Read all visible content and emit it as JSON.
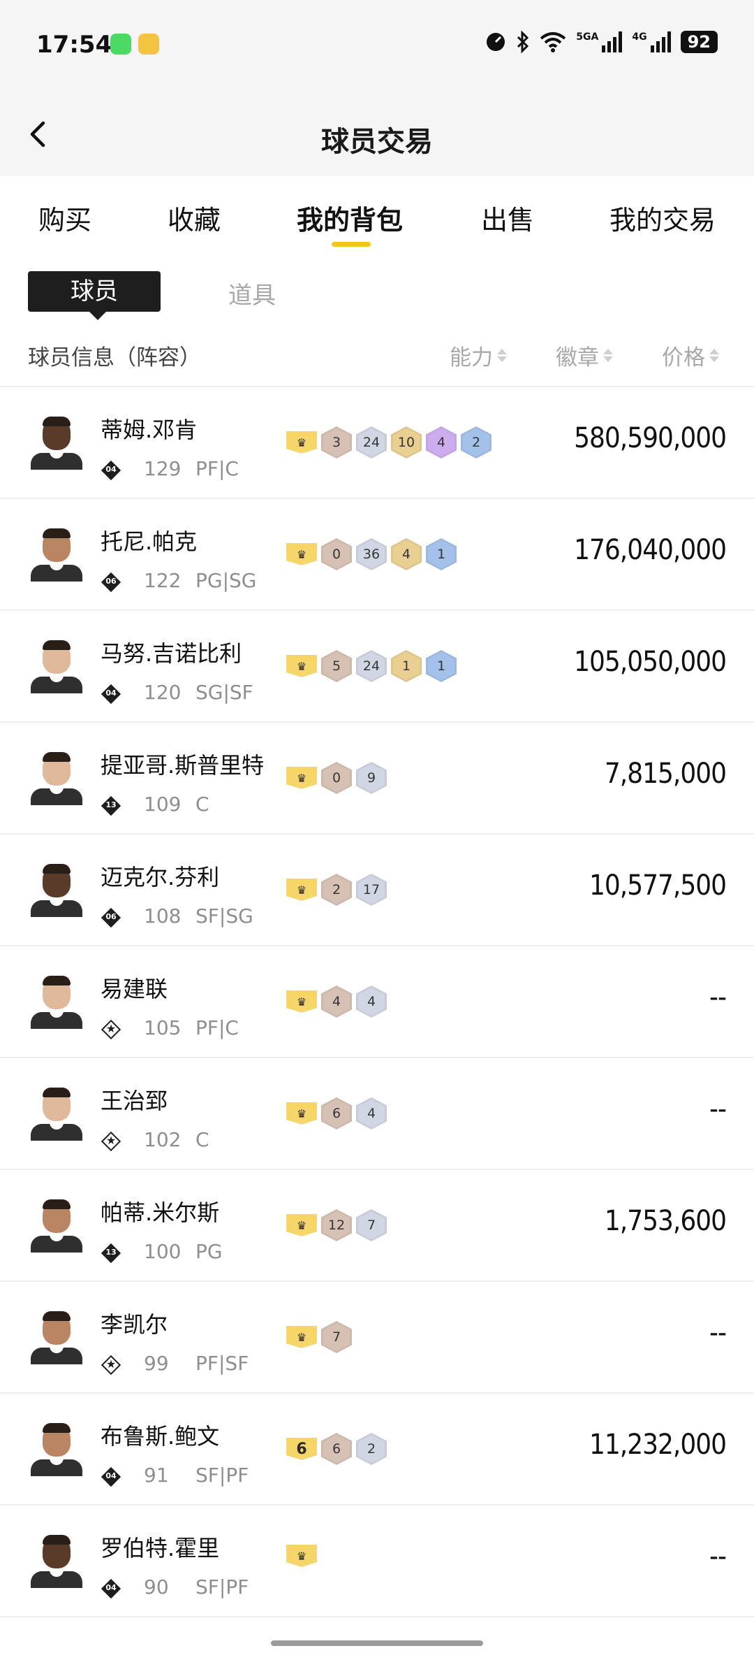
{
  "status_bar": {
    "time": "17:54",
    "battery": "92",
    "sim1_tag": "5GA",
    "sim2_tag": "4G"
  },
  "header": {
    "title": "球员交易"
  },
  "tabs": [
    {
      "label": "购买",
      "active": false
    },
    {
      "label": "收藏",
      "active": false
    },
    {
      "label": "我的背包",
      "active": true
    },
    {
      "label": "出售",
      "active": false
    },
    {
      "label": "我的交易",
      "active": false
    }
  ],
  "segment": {
    "players": "球员",
    "items": "道具"
  },
  "columns": {
    "info": "球员信息（阵容）",
    "ability": "能力",
    "badge": "徽章",
    "price": "价格"
  },
  "badge_colors": {
    "bronze": "#cdb8ac",
    "silver": "#c6ccd8",
    "gold": "#dfc58b",
    "purple": "#c4a5e3",
    "blue": "#9cb8de",
    "crown": "#f6d66b",
    "price_accent": "#f5c518"
  },
  "players": [
    {
      "name": "蒂姆.邓肯",
      "team": "04",
      "team_style": "num",
      "rating": "129",
      "position": "PF|C",
      "crown": "",
      "badges": [
        {
          "t": "bronze",
          "v": "3"
        },
        {
          "t": "silver",
          "v": "24"
        },
        {
          "t": "gold",
          "v": "10"
        },
        {
          "t": "purple",
          "v": "4"
        },
        {
          "t": "blue",
          "v": "2"
        }
      ],
      "price": "580,590,000",
      "skin": "dark"
    },
    {
      "name": "托尼.帕克",
      "team": "06",
      "team_style": "num",
      "rating": "122",
      "position": "PG|SG",
      "crown": "",
      "badges": [
        {
          "t": "bronze",
          "v": "0"
        },
        {
          "t": "silver",
          "v": "36"
        },
        {
          "t": "gold",
          "v": "4"
        },
        {
          "t": "blue",
          "v": "1"
        }
      ],
      "price": "176,040,000",
      "skin": "tan"
    },
    {
      "name": "马努.吉诺比利",
      "team": "04",
      "team_style": "num",
      "rating": "120",
      "position": "SG|SF",
      "crown": "",
      "badges": [
        {
          "t": "bronze",
          "v": "5"
        },
        {
          "t": "silver",
          "v": "24"
        },
        {
          "t": "gold",
          "v": "1"
        },
        {
          "t": "blue",
          "v": "1"
        }
      ],
      "price": "105,050,000",
      "skin": "light"
    },
    {
      "name": "提亚哥.斯普里特",
      "team": "13",
      "team_style": "num",
      "rating": "109",
      "position": "C",
      "crown": "",
      "badges": [
        {
          "t": "bronze",
          "v": "0"
        },
        {
          "t": "silver",
          "v": "9"
        }
      ],
      "price": "7,815,000",
      "skin": "light"
    },
    {
      "name": "迈克尔.芬利",
      "team": "06",
      "team_style": "num",
      "rating": "108",
      "position": "SF|SG",
      "crown": "",
      "badges": [
        {
          "t": "bronze",
          "v": "2"
        },
        {
          "t": "silver",
          "v": "17"
        }
      ],
      "price": "10,577,500",
      "skin": "dark"
    },
    {
      "name": "易建联",
      "team": "★",
      "team_style": "star",
      "rating": "105",
      "position": "PF|C",
      "crown": "",
      "badges": [
        {
          "t": "bronze",
          "v": "4"
        },
        {
          "t": "silver",
          "v": "4"
        }
      ],
      "price": "--",
      "skin": "light"
    },
    {
      "name": "王治郅",
      "team": "★",
      "team_style": "star",
      "rating": "102",
      "position": "C",
      "crown": "",
      "badges": [
        {
          "t": "bronze",
          "v": "6"
        },
        {
          "t": "silver",
          "v": "4"
        }
      ],
      "price": "--",
      "skin": "light"
    },
    {
      "name": "帕蒂.米尔斯",
      "team": "13",
      "team_style": "num",
      "rating": "100",
      "position": "PG",
      "crown": "",
      "badges": [
        {
          "t": "bronze",
          "v": "12"
        },
        {
          "t": "silver",
          "v": "7"
        }
      ],
      "price": "1,753,600",
      "skin": "tan"
    },
    {
      "name": "李凯尔",
      "team": "★",
      "team_style": "star",
      "rating": "99",
      "position": "PF|SF",
      "crown": "",
      "badges": [
        {
          "t": "bronze",
          "v": "7"
        }
      ],
      "price": "--",
      "skin": "tan"
    },
    {
      "name": "布鲁斯.鲍文",
      "team": "04",
      "team_style": "num",
      "rating": "91",
      "position": "SF|PF",
      "crown": "6",
      "badges": [
        {
          "t": "bronze",
          "v": "6"
        },
        {
          "t": "silver",
          "v": "2"
        }
      ],
      "price": "11,232,000",
      "skin": "tan"
    },
    {
      "name": "罗伯特.霍里",
      "team": "04",
      "team_style": "num",
      "rating": "90",
      "position": "SF|PF",
      "crown": "",
      "badges": [],
      "price": "--",
      "skin": "dark"
    }
  ]
}
